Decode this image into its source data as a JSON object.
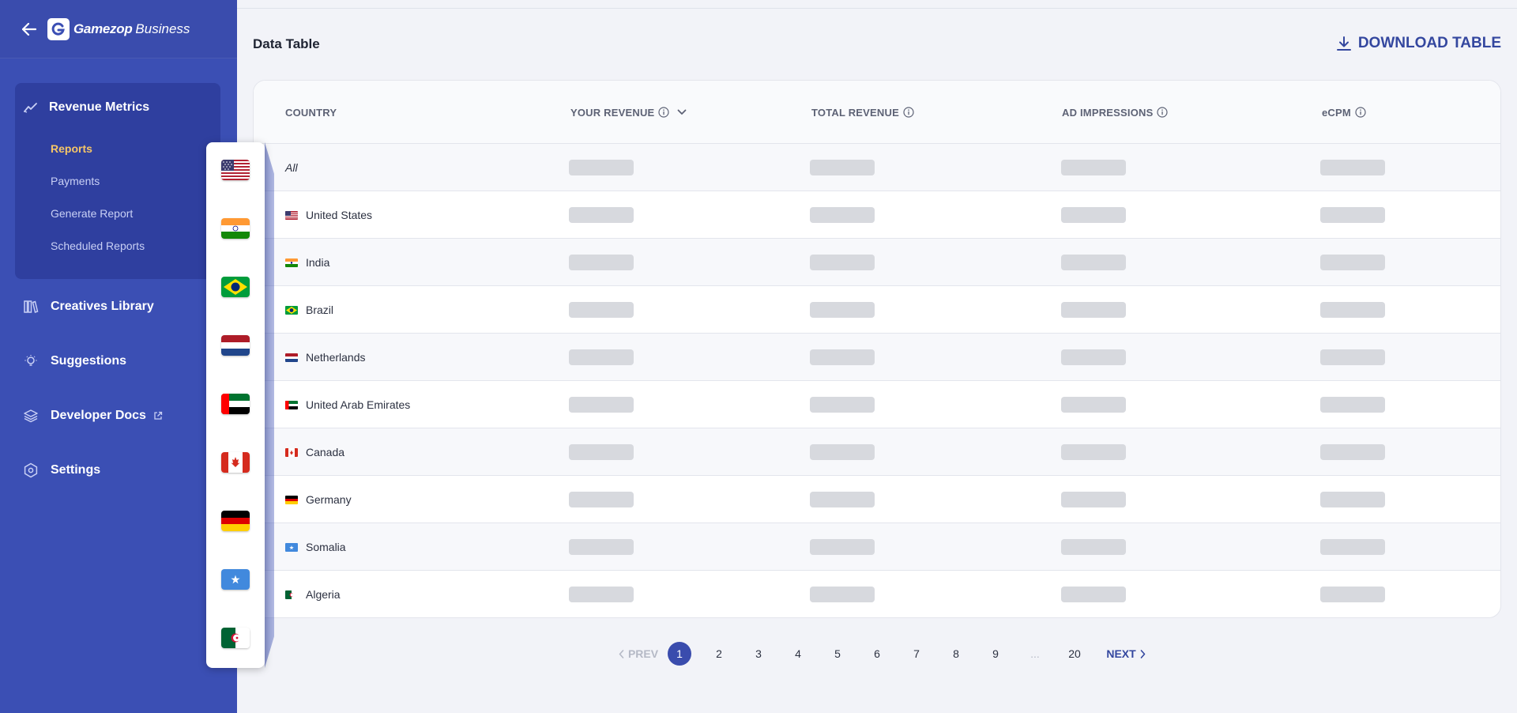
{
  "sidebar": {
    "logo_name": "Gamezop",
    "logo_suffix": "Business",
    "revenue_metrics": "Revenue Metrics",
    "sub_items": [
      "Reports",
      "Payments",
      "Generate Report",
      "Scheduled Reports"
    ],
    "active_sub": "Reports",
    "nav": {
      "creatives": "Creatives Library",
      "suggestions": "Suggestions",
      "developer_docs": "Developer Docs",
      "settings": "Settings"
    }
  },
  "main": {
    "title": "Data Table",
    "download_label": "DOWNLOAD TABLE"
  },
  "table": {
    "headers": {
      "country": "COUNTRY",
      "your_revenue": "YOUR REVENUE",
      "total_revenue": "TOTAL REVENUE",
      "ad_impressions": "AD IMPRESSIONS",
      "ecpm": "eCPM"
    },
    "rows": [
      {
        "country": "All",
        "flag": ""
      },
      {
        "country": "United States",
        "flag": "us"
      },
      {
        "country": "India",
        "flag": "in"
      },
      {
        "country": "Brazil",
        "flag": "br"
      },
      {
        "country": "Netherlands",
        "flag": "nl"
      },
      {
        "country": "United Arab Emirates",
        "flag": "ae"
      },
      {
        "country": "Canada",
        "flag": "ca"
      },
      {
        "country": "Germany",
        "flag": "de"
      },
      {
        "country": "Somalia",
        "flag": "so"
      },
      {
        "country": "Algeria",
        "flag": "dz"
      }
    ]
  },
  "flag_popover": [
    "us",
    "in",
    "br",
    "nl",
    "ae",
    "ca",
    "de",
    "so",
    "dz"
  ],
  "pagination": {
    "prev": "PREV",
    "next": "NEXT",
    "pages": [
      "1",
      "2",
      "3",
      "4",
      "5",
      "6",
      "7",
      "8",
      "9"
    ],
    "ellipsis": "...",
    "last": "20",
    "current": "1"
  },
  "colors": {
    "sidebar": "#3b4fb4",
    "sidebar_group": "#2f3f9f",
    "accent": "#3a4cad",
    "active_link": "#f6c667",
    "skeleton": "#d7d9de"
  }
}
